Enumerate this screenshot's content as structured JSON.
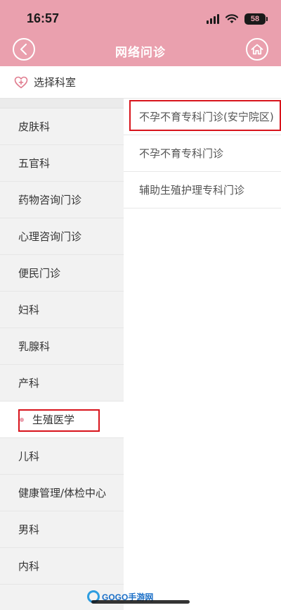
{
  "status_bar": {
    "time": "16:57",
    "battery": "58",
    "icons": [
      "cellular-signal-icon",
      "wifi-icon",
      "battery-icon"
    ]
  },
  "nav": {
    "title": "网络问诊",
    "back_icon": "chevron-left-icon",
    "home_icon": "home-icon"
  },
  "section": {
    "icon": "heart-plus-icon",
    "label": "选择科室"
  },
  "departments": [
    {
      "label": "皮肤科"
    },
    {
      "label": "五官科"
    },
    {
      "label": "药物咨询门诊"
    },
    {
      "label": "心理咨询门诊"
    },
    {
      "label": "便民门诊"
    },
    {
      "label": "妇科"
    },
    {
      "label": "乳腺科"
    },
    {
      "label": "产科"
    },
    {
      "label": "生殖医学",
      "selected": true
    },
    {
      "label": "儿科"
    },
    {
      "label": "健康管理/体检中心"
    },
    {
      "label": "男科"
    },
    {
      "label": "内科"
    }
  ],
  "clinics": [
    {
      "label": "不孕不育专科门诊(安宁院区)"
    },
    {
      "label": "不孕不育专科门诊"
    },
    {
      "label": "辅助生殖护理专科门诊"
    }
  ],
  "watermark": {
    "text": "GOGO手游网"
  },
  "colors": {
    "brand_pink": "#eaa0ae",
    "highlight_red": "#d8141c"
  }
}
